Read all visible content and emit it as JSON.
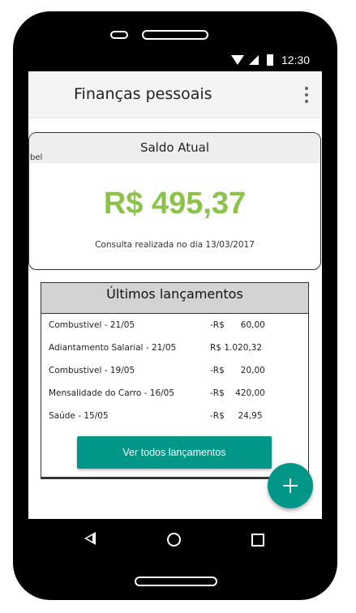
{
  "status_bar": {
    "time": "12:30"
  },
  "app_bar": {
    "title": "Finanças pessoais"
  },
  "balance_card": {
    "header": "Saldo Atual",
    "stray_label": "bel",
    "value": "R$ 495,37",
    "caption": "Consulta realizada no dia 13/03/2017",
    "value_color": "#8bc34a"
  },
  "entries": {
    "header": "Últimos lançamentos",
    "items": [
      {
        "description": "Combustivel - 21/05",
        "amount": "-R$      60,00"
      },
      {
        "description": "Adiantamento Salarial - 21/05",
        "amount": "R$ 1.020,32"
      },
      {
        "description": "Combustivel - 19/05",
        "amount": "-R$      20,00"
      },
      {
        "description": "Mensalidade do Carro  - 16/05",
        "amount": "-R$    420,00"
      },
      {
        "description": "Saúde - 15/05",
        "amount": "-R$     24,95"
      }
    ],
    "see_all_label": "Ver todos lançamentos"
  },
  "fab": {
    "icon": "plus-icon"
  },
  "nav": {
    "back_icon": "back-triangle-icon",
    "home_icon": "home-circle-icon",
    "recents_icon": "recents-square-icon"
  },
  "colors": {
    "accent": "#009688",
    "balance_green": "#8bc34a"
  }
}
